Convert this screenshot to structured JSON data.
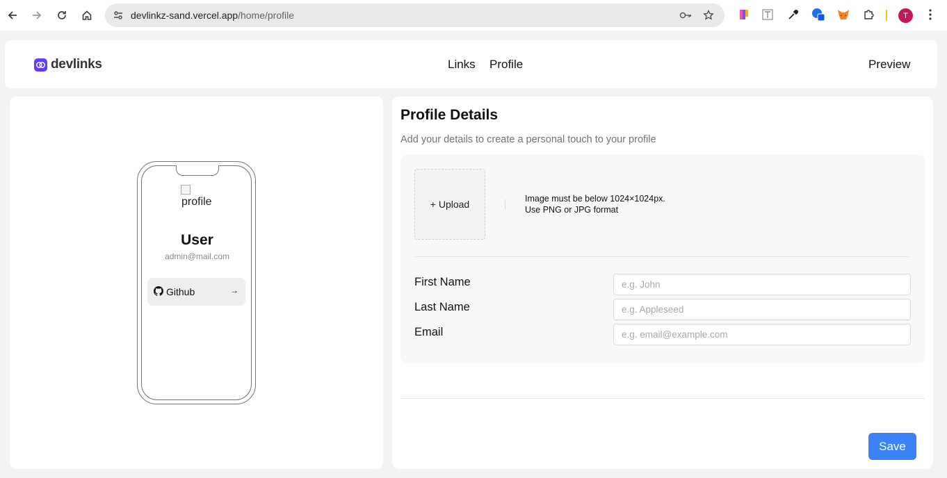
{
  "browser": {
    "url_host": "devlinkz-sand.vercel.app",
    "url_path": "/home/profile",
    "profile_initial": "T"
  },
  "app": {
    "logo_text": "devlinks",
    "nav": {
      "links": "Links",
      "profile": "Profile"
    },
    "preview": "Preview",
    "accent_color": "#633cff"
  },
  "phone_preview": {
    "image_alt": "profile",
    "name": "User",
    "email": "admin@mail.com",
    "links": [
      {
        "platform": "Github",
        "icon": "github-icon",
        "arrow": "→"
      }
    ]
  },
  "profile_form": {
    "title": "Profile Details",
    "subtitle": "Add your details to create a personal touch to your profile",
    "upload_label": "+ Upload",
    "image_hint_line1": "Image must be below 1024×1024px.",
    "image_hint_line2": "Use PNG or JPG format",
    "fields": {
      "first_name": {
        "label": "First Name",
        "placeholder": "e.g. John",
        "value": ""
      },
      "last_name": {
        "label": "Last Name",
        "placeholder": "e.g. Appleseed",
        "value": ""
      },
      "email": {
        "label": "Email",
        "placeholder": "e.g. email@example.com",
        "value": ""
      }
    },
    "save_label": "Save",
    "save_color": "#3b82f6"
  }
}
